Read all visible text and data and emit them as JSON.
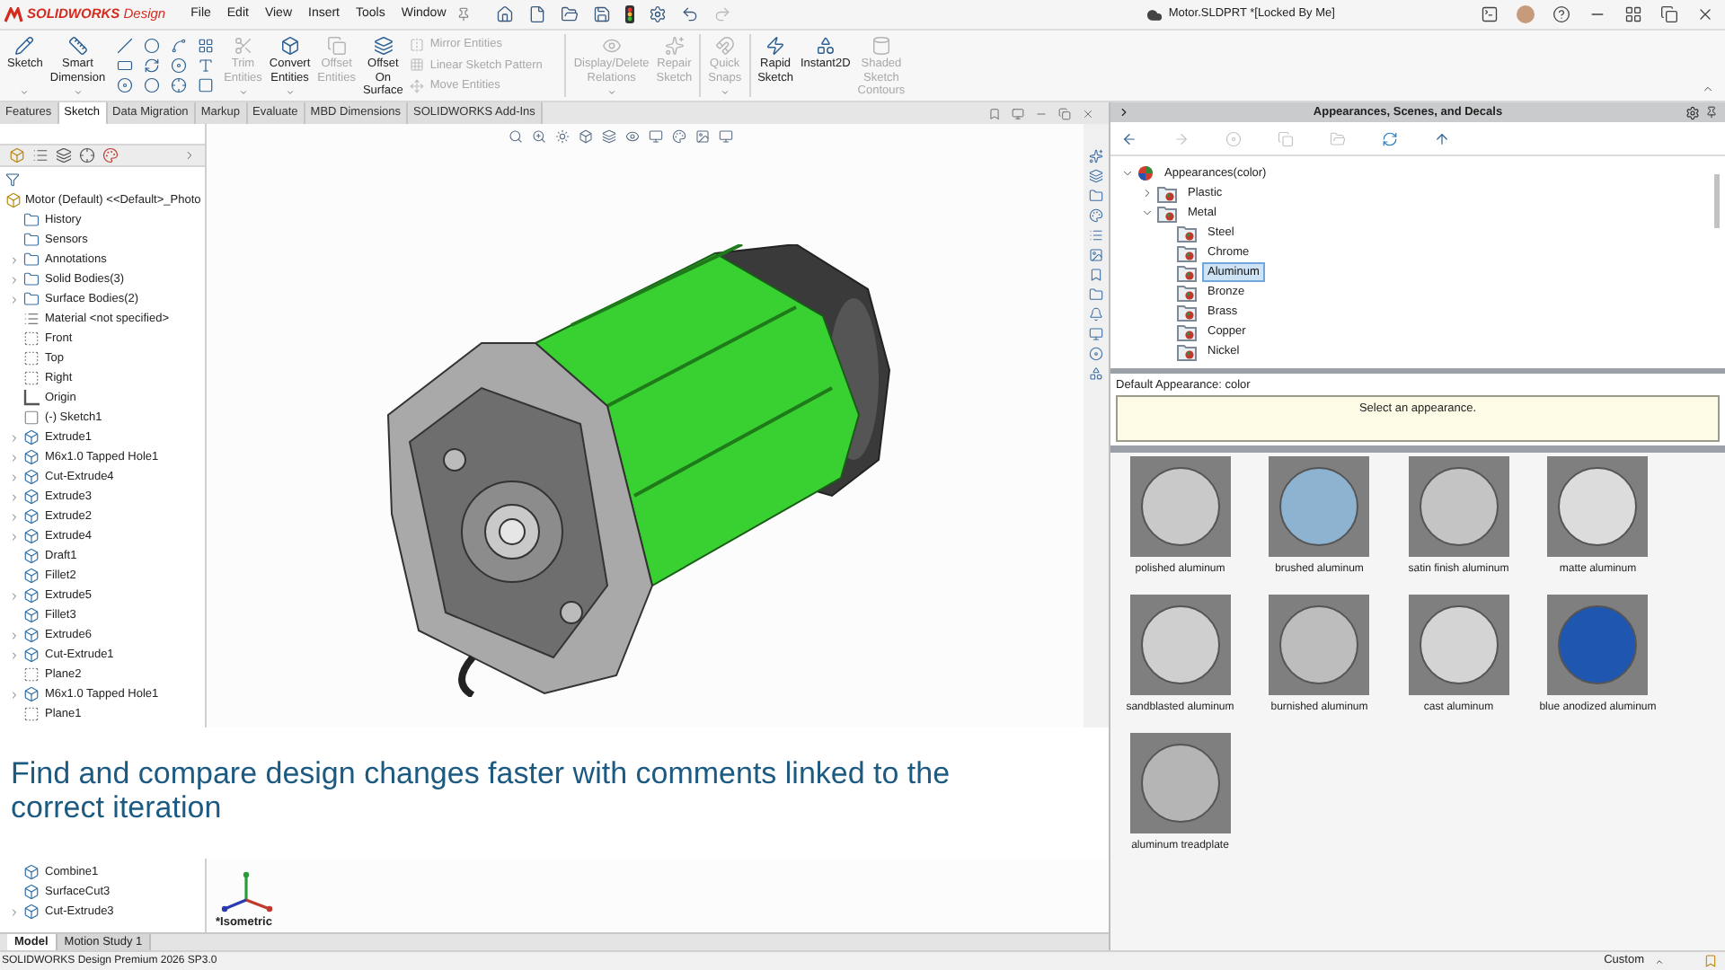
{
  "title_bar": {
    "logo": "**SOLIDWORKS** Design",
    "menus": [
      "File",
      "Edit",
      "View",
      "Insert",
      "Tools",
      "Window"
    ],
    "document": "Motor.SLDPRT *[Locked By Me]"
  },
  "ribbon": [
    {
      "kind": "large",
      "label": "Sketch",
      "disabled": false,
      "dropdown": true
    },
    {
      "kind": "large",
      "label": "Smart Dimension",
      "disabled": false,
      "dropdown": true
    },
    {
      "kind": "tool_grid"
    },
    {
      "kind": "large",
      "label": "Trim Entities",
      "disabled": true,
      "dropdown": true
    },
    {
      "kind": "large",
      "label": "Convert Entities",
      "disabled": false,
      "dropdown": true
    },
    {
      "kind": "large",
      "label": "Offset Entities",
      "disabled": true,
      "dropdown": false
    },
    {
      "kind": "large",
      "label": "Offset On Surface",
      "disabled": false
    },
    {
      "kind": "list",
      "items": [
        {
          "label": "Mirror Entities",
          "disabled": true
        },
        {
          "label": "Linear Sketch Pattern",
          "disabled": true
        },
        {
          "label": "Move Entities",
          "disabled": true
        }
      ]
    },
    {
      "kind": "separator"
    },
    {
      "kind": "large",
      "label": "Display/Delete Relations",
      "disabled": true,
      "dropdown": true
    },
    {
      "kind": "large",
      "label": "Repair Sketch",
      "disabled": true,
      "dropdown": false
    },
    {
      "kind": "separator"
    },
    {
      "kind": "large",
      "label": "Quick Snaps",
      "disabled": true,
      "dropdown": true
    },
    {
      "kind": "separator"
    },
    {
      "kind": "large",
      "label": "Rapid Sketch",
      "disabled": false,
      "dropdown": false
    },
    {
      "kind": "large",
      "label": "Instant2D",
      "disabled": false,
      "dropdown": false
    },
    {
      "kind": "large",
      "label": "Shaded Sketch Contours",
      "disabled": true,
      "dropdown": false
    }
  ],
  "command_tabs": [
    {
      "label": "Features",
      "selected": false
    },
    {
      "label": "Sketch",
      "selected": true
    },
    {
      "label": "Data Migration",
      "selected": false
    },
    {
      "label": "Markup",
      "selected": false
    },
    {
      "label": "Evaluate",
      "selected": false
    },
    {
      "label": "MBD Dimensions",
      "selected": false
    },
    {
      "label": "SOLIDWORKS Add-Ins",
      "selected": false
    }
  ],
  "feature_tree": {
    "root": "Motor (Default) <<Default>_Photo",
    "items": [
      {
        "label": "History",
        "kind": "folder",
        "expandable": false
      },
      {
        "label": "Sensors",
        "kind": "folder",
        "expandable": false
      },
      {
        "label": "Annotations",
        "kind": "folder",
        "expandable": true
      },
      {
        "label": "Solid Bodies(3)",
        "kind": "folder",
        "expandable": true
      },
      {
        "label": "Surface Bodies(2)",
        "kind": "folder",
        "expandable": true
      },
      {
        "label": "Material <not specified>",
        "kind": "material",
        "expandable": false
      },
      {
        "label": "Front",
        "kind": "plane",
        "expandable": false
      },
      {
        "label": "Top",
        "kind": "plane",
        "expandable": false
      },
      {
        "label": "Right",
        "kind": "plane",
        "expandable": false
      },
      {
        "label": "Origin",
        "kind": "origin",
        "expandable": false
      },
      {
        "label": "(-) Sketch1",
        "kind": "sketch",
        "expandable": false
      },
      {
        "label": "Extrude1",
        "kind": "feature",
        "expandable": true
      },
      {
        "label": "M6x1.0 Tapped Hole1",
        "kind": "feature",
        "expandable": true
      },
      {
        "label": "Cut-Extrude4",
        "kind": "feature",
        "expandable": true
      },
      {
        "label": "Extrude3",
        "kind": "feature",
        "expandable": true
      },
      {
        "label": "Extrude2",
        "kind": "feature",
        "expandable": true
      },
      {
        "label": "Extrude4",
        "kind": "feature",
        "expandable": true
      },
      {
        "label": "Draft1",
        "kind": "feature",
        "expandable": false
      },
      {
        "label": "Fillet2",
        "kind": "feature",
        "expandable": false
      },
      {
        "label": "Extrude5",
        "kind": "feature",
        "expandable": true
      },
      {
        "label": "Fillet3",
        "kind": "feature",
        "expandable": false
      },
      {
        "label": "Extrude6",
        "kind": "feature",
        "expandable": true
      },
      {
        "label": "Cut-Extrude1",
        "kind": "feature",
        "expandable": true
      },
      {
        "label": "Plane2",
        "kind": "plane",
        "expandable": false
      },
      {
        "label": "M6x1.0 Tapped Hole1",
        "kind": "feature",
        "expandable": true
      },
      {
        "label": "Plane1",
        "kind": "plane",
        "expandable": false
      }
    ],
    "lower_items": [
      {
        "label": "Combine1",
        "kind": "feature",
        "expandable": false
      },
      {
        "label": "SurfaceCut3",
        "kind": "feature",
        "expandable": false
      },
      {
        "label": "Cut-Extrude3",
        "kind": "feature",
        "expandable": true
      }
    ]
  },
  "caption": "Find and compare design changes faster with comments linked to the correct iteration",
  "view_label": "*Isometric",
  "bottom_tabs": [
    {
      "label": "Model",
      "selected": true
    },
    {
      "label": "Motion Study 1",
      "selected": false
    }
  ],
  "status_bar": {
    "version": "SOLIDWORKS Design Premium 2026 SP3.0",
    "units": "Custom"
  },
  "task_pane": {
    "title": "Appearances, Scenes, and Decals",
    "tree": [
      {
        "label": "Appearances(color)",
        "expanded": true,
        "selected": false,
        "children": [
          {
            "label": "Plastic",
            "expanded": false,
            "selected": false
          },
          {
            "label": "Metal",
            "expanded": true,
            "selected": false,
            "children": [
              {
                "label": "Steel",
                "selected": false
              },
              {
                "label": "Chrome",
                "selected": false
              },
              {
                "label": "Aluminum",
                "selected": true
              },
              {
                "label": "Bronze",
                "selected": false
              },
              {
                "label": "Brass",
                "selected": false
              },
              {
                "label": "Copper",
                "selected": false
              },
              {
                "label": "Nickel",
                "selected": false
              }
            ]
          }
        ]
      }
    ],
    "description_label": "Default Appearance: color",
    "message": "Select an appearance.",
    "swatches": [
      {
        "label": "polished aluminum",
        "color": "#c9c9c9"
      },
      {
        "label": "brushed aluminum",
        "color": "#8db3d1"
      },
      {
        "label": "satin finish aluminum",
        "color": "#c4c4c4"
      },
      {
        "label": "matte aluminum",
        "color": "#dcdcdc"
      },
      {
        "label": "sandblasted aluminum",
        "color": "#cfcfcf"
      },
      {
        "label": "burnished aluminum",
        "color": "#bdbdbd"
      },
      {
        "label": "cast aluminum",
        "color": "#d4d4d4"
      },
      {
        "label": "blue anodized aluminum",
        "color": "#1f57b0"
      },
      {
        "label": "aluminum treadplate",
        "color": "#b5b5b5"
      }
    ]
  }
}
